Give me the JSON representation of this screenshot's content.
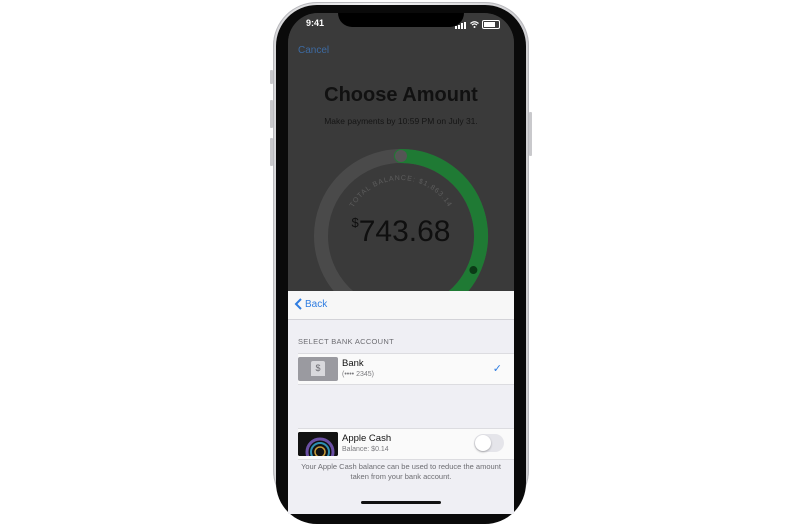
{
  "status_bar": {
    "time": "9:41"
  },
  "background_screen": {
    "cancel_label": "Cancel",
    "title": "Choose Amount",
    "subtitle": "Make payments by 10:59 PM on July 31.",
    "gauge_label": "TOTAL BALANCE: $1,863.14",
    "currency_symbol": "$",
    "amount": "743.68",
    "gauge_fraction": 0.4
  },
  "sheet": {
    "back_label": "Back",
    "section_label": "SELECT BANK ACCOUNT",
    "bank": {
      "name": "Bank",
      "detail": "(•••• 2345)",
      "selected": true,
      "icon": "bank-building-icon"
    },
    "apple_cash": {
      "name": "Apple Cash",
      "detail": "Balance: $0.14",
      "toggle_on": false,
      "icon": "apple-cash-card-icon"
    },
    "footnote": "Your Apple Cash balance can be used to reduce the amount taken from your bank account."
  },
  "colors": {
    "accent": "#2f7de1",
    "gauge_green": "#1f7a34",
    "dim_bg": "#3a3a3a"
  }
}
